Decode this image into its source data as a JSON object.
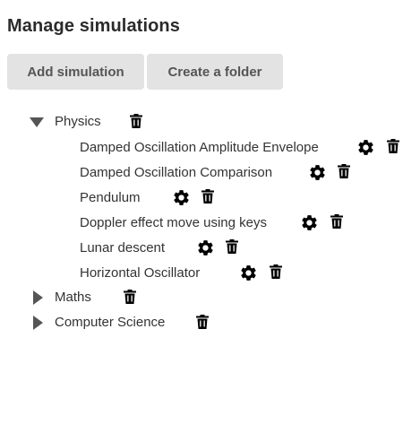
{
  "page_title": "Manage simulations",
  "buttons": {
    "add_simulation": "Add simulation",
    "create_folder": "Create a folder"
  },
  "folders": [
    {
      "name": "Physics",
      "expanded": true,
      "simulations": [
        {
          "name": "Damped Oscillation Amplitude Envelope"
        },
        {
          "name": "Damped Oscillation Comparison"
        },
        {
          "name": "Pendulum"
        },
        {
          "name": "Doppler effect move using keys"
        },
        {
          "name": "Lunar descent"
        },
        {
          "name": "Horizontal Oscillator"
        }
      ]
    },
    {
      "name": "Maths",
      "expanded": false
    },
    {
      "name": "Computer Science",
      "expanded": false
    }
  ],
  "icons": {
    "expanded": "triangle-down-icon",
    "collapsed": "triangle-right-icon",
    "settings": "gear-icon",
    "delete": "trash-icon"
  },
  "colors": {
    "button_bg": "#e3e3e3",
    "button_text": "#555555",
    "title_text": "#2b2b2b",
    "icon": "#000000"
  }
}
